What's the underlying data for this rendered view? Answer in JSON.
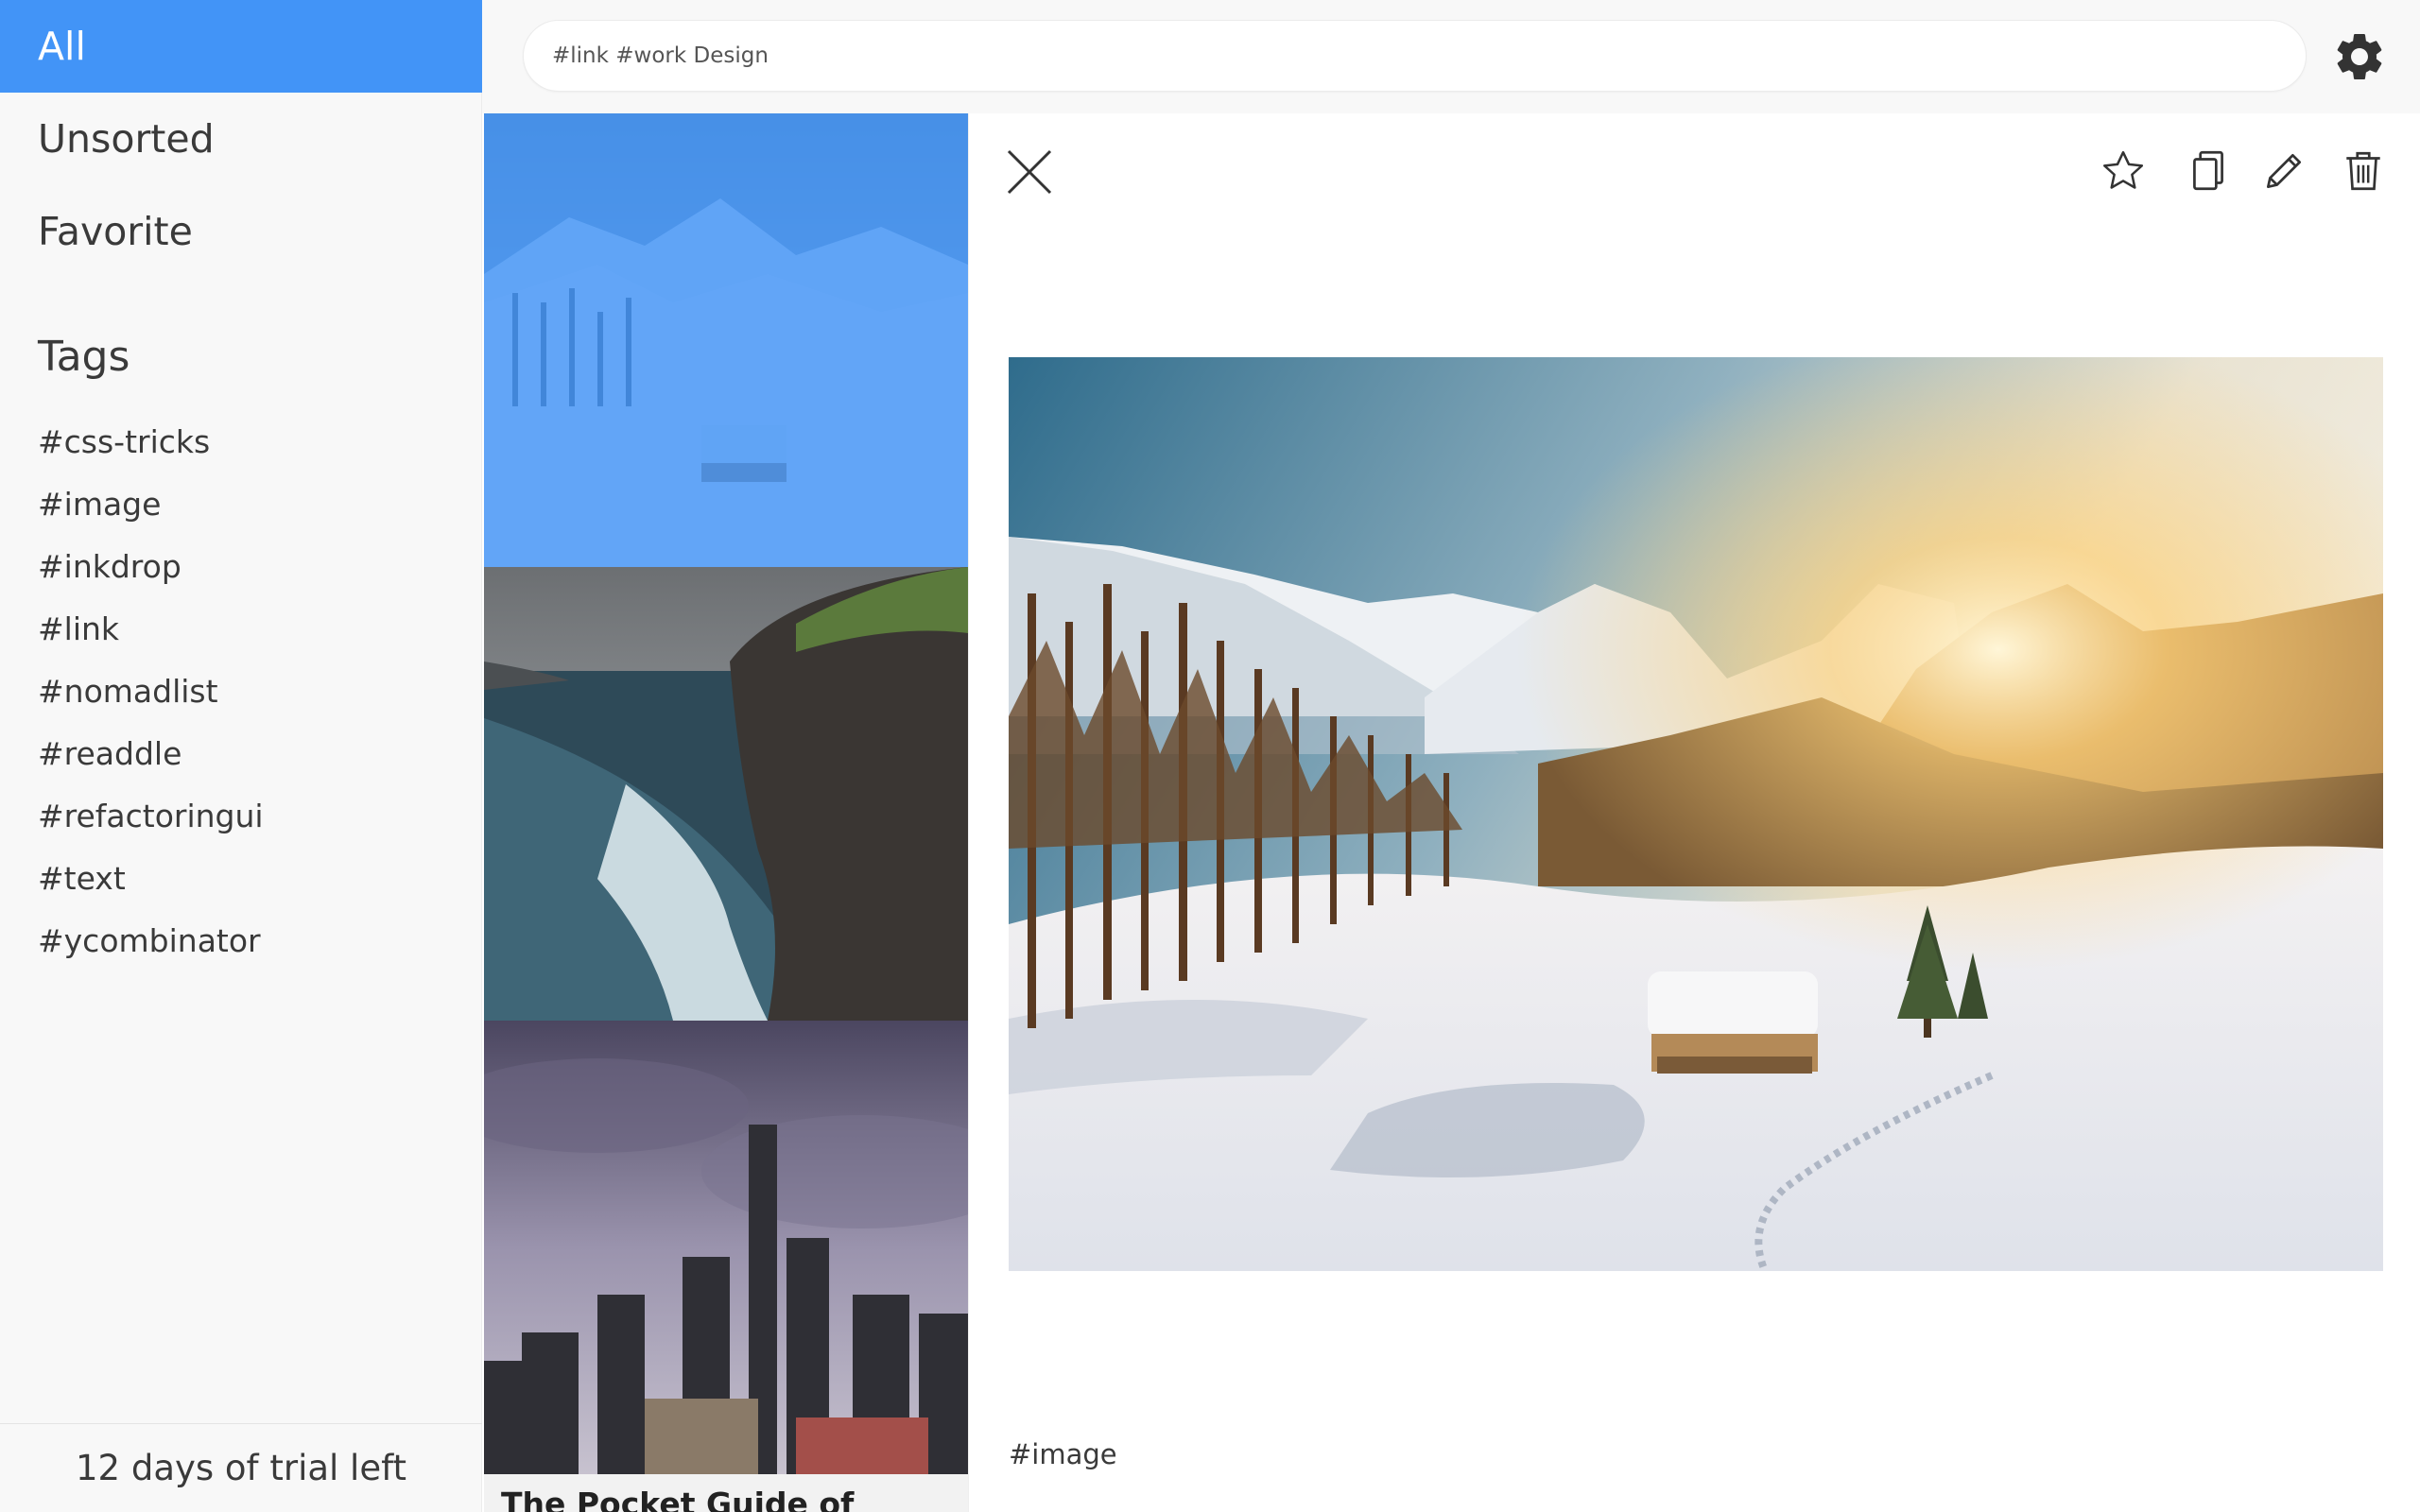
{
  "sidebar": {
    "nav": [
      {
        "label": "All",
        "active": true
      },
      {
        "label": "Unsorted",
        "active": false
      },
      {
        "label": "Favorite",
        "active": false
      }
    ],
    "tags_heading": "Tags",
    "tags": [
      "#css-tricks",
      "#image",
      "#inkdrop",
      "#link",
      "#nomadlist",
      "#readdle",
      "#refactoringui",
      "#text",
      "#ycombinator"
    ],
    "trial_text": "12 days of trial left"
  },
  "header": {
    "search_value": "#link #work Design",
    "settings_icon": "gear-icon"
  },
  "list": {
    "items": [
      {
        "image": "snowy-valley-cabin",
        "selected": true
      },
      {
        "image": "sea-cliff-waves",
        "selected": false
      },
      {
        "image": "city-skyline-storm",
        "selected": false
      }
    ],
    "partial_title": "The Pocket Guide of"
  },
  "detail": {
    "toolbar_icons": [
      "close-icon",
      "star-icon",
      "copy-icon",
      "pencil-icon",
      "trash-icon"
    ],
    "image": "snowy-valley-cabin-sunrise",
    "tag": "#image"
  },
  "colors": {
    "accent": "#4294f7",
    "sidebar_bg": "#f8f8f8",
    "text": "#3a3a3a"
  }
}
